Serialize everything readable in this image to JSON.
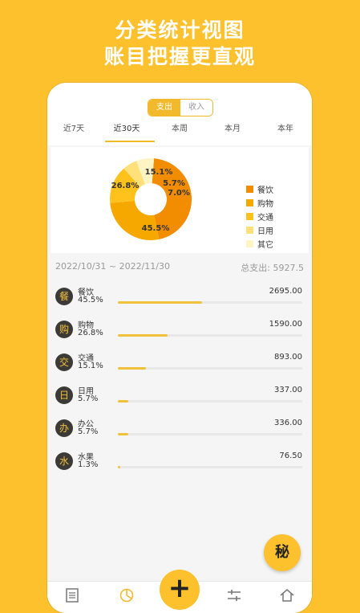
{
  "headline": {
    "line1": "分类统计视图",
    "line2": "账目把握更直观"
  },
  "segment": {
    "expense": "支出",
    "income": "收入"
  },
  "tabs": [
    "近7天",
    "近30天",
    "本周",
    "本月",
    "本年"
  ],
  "active_tab": "近30天",
  "chart_data": {
    "type": "pie",
    "donut": true,
    "slices": [
      {
        "name": "餐饮",
        "value": 45.5,
        "label": "45.5%",
        "color": "#F28C00"
      },
      {
        "name": "购物",
        "value": 26.8,
        "label": "26.8%",
        "color": "#F6A800"
      },
      {
        "name": "交通",
        "value": 15.1,
        "label": "15.1%",
        "color": "#FFC21C"
      },
      {
        "name": "日用",
        "value": 5.7,
        "label": "5.7%",
        "color": "#FFE07A"
      },
      {
        "name": "其它",
        "value": 7.0,
        "label": "7.0%",
        "color": "#FFF4C4"
      }
    ],
    "legend": [
      "餐饮",
      "购物",
      "交通",
      "日用",
      "其它"
    ],
    "legend_position": "right"
  },
  "summary": {
    "date_range": "2022/10/31 ~ 2022/11/30",
    "total": "总支出: 5927.5"
  },
  "categories": [
    {
      "icon": "餐",
      "name": "餐饮",
      "pct": "45.5%",
      "amount": "2695.00",
      "fraction": 0.455
    },
    {
      "icon": "购",
      "name": "购物",
      "pct": "26.8%",
      "amount": "1590.00",
      "fraction": 0.268
    },
    {
      "icon": "交",
      "name": "交通",
      "pct": "15.1%",
      "amount": "893.00",
      "fraction": 0.151
    },
    {
      "icon": "日",
      "name": "日用",
      "pct": "5.7%",
      "amount": "337.00",
      "fraction": 0.057
    },
    {
      "icon": "办",
      "name": "办公",
      "pct": "5.7%",
      "amount": "336.00",
      "fraction": 0.057
    },
    {
      "icon": "水",
      "name": "水果",
      "pct": "1.3%",
      "amount": "76.50",
      "fraction": 0.013
    }
  ],
  "fab_label": "秘",
  "add_label": "+",
  "bottom_nav": [
    "list-icon",
    "chart-icon",
    "add-icon",
    "settings-icon",
    "home-icon"
  ],
  "colors": {
    "accent": "#FCC12C",
    "bar": "#F2C13A",
    "icon_bg": "#3C3A36"
  }
}
